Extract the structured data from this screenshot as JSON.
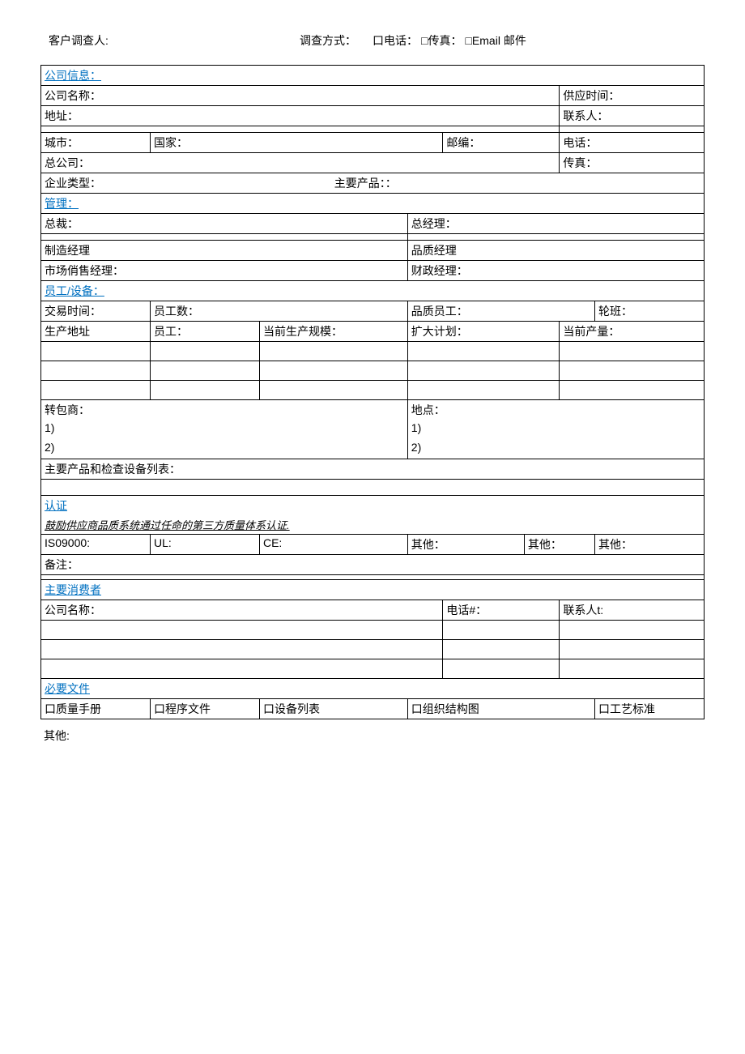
{
  "header": {
    "investigator": "客户调查人:",
    "method_label": "调查方式：",
    "phone": "口电话：",
    "fax": "□传真：",
    "email": "□Email 邮件"
  },
  "company": {
    "title": "公司信息：",
    "name": "公司名称：",
    "supply_time": "供应时间：",
    "address": "地址：",
    "contact": "联系人：",
    "city": "城市：",
    "country": "国家：",
    "postal": "邮编：",
    "tel": "电话：",
    "parent": "总公司：",
    "fax": "传真：",
    "type": "企业类型：",
    "main_product": "主要产品：："
  },
  "mgmt": {
    "title": "管理：",
    "president": "总裁：",
    "gm": "总经理：",
    "mfg_mgr": "制造经理",
    "qa_mgr": "品质经理",
    "sales_mgr": "市场俏售经理：",
    "fin_mgr": "财政经理："
  },
  "staff": {
    "title": "员工/设备：",
    "trade_time": "交易时间：",
    "emp_count": "员工数：",
    "qa_emp": "品质员工：",
    "shift": "轮班：",
    "prod_addr": "生产地址",
    "emp": "员工：",
    "scale": "当前生产规模：",
    "expand": "扩大计划：",
    "output": "当前产量：",
    "subcon": "转包商：",
    "location": "地点：",
    "one": "1)",
    "two": "2)",
    "equip_list": "主要产品和检查设备列表："
  },
  "cert": {
    "title": "认证",
    "note": "鼓励供应商品质系统通过任命的第三方质量体系认证.",
    "iso": "IS09000:",
    "ul": "UL:",
    "ce": "CE:",
    "other1": "其他：",
    "other2": "其他：",
    "other3": "其他：",
    "remark": "备注："
  },
  "customer": {
    "title": "主要消费者",
    "name": "公司名称：",
    "tel": "电话#：",
    "contact": "联系人t:"
  },
  "docs": {
    "title": "必要文件",
    "manual": "口质量手册",
    "procedure": "口程序文件",
    "equip": "口设备列表",
    "org": "口组织结构图",
    "process": "口工艺标准",
    "other": "其他:"
  }
}
